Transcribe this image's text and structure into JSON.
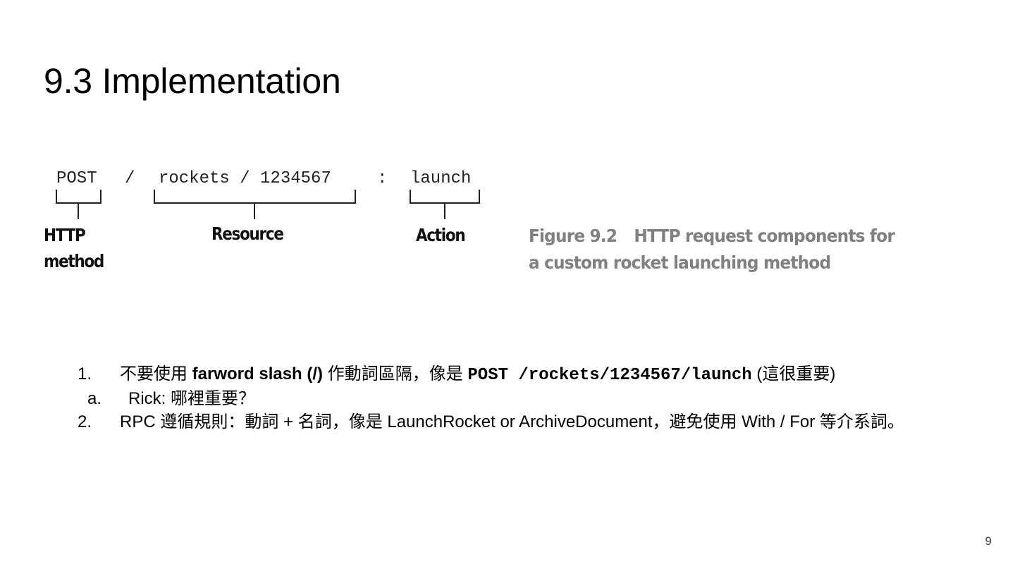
{
  "slide": {
    "title": "9.3 Implementation",
    "page_number": "9"
  },
  "figure": {
    "segments": {
      "method": "POST",
      "slash1": "/",
      "resource": "rockets / 1234567",
      "colon": ":",
      "action": "launch"
    },
    "labels": {
      "method_line1": "HTTP",
      "method_line2": "method",
      "resource": "Resource",
      "action": "Action"
    },
    "caption": {
      "number": "Figure 9.2",
      "text_line1": "HTTP request components for",
      "text_line2": "a custom rocket launching method"
    }
  },
  "list": {
    "item1": {
      "marker": "1.",
      "text_a": "不要使用 ",
      "bold": "farword slash (/)",
      "text_b": " 作動詞區隔，像是 ",
      "code": "POST /rockets/1234567/launch",
      "text_c": " (這很重要)",
      "sub": {
        "marker": "a.",
        "text": "Rick: 哪裡重要？"
      }
    },
    "item2": {
      "marker": "2.",
      "text": "RPC 遵循規則：動詞 + 名詞，像是 LaunchRocket or ArchiveDocument，避免使用 With / For 等介系詞。"
    }
  }
}
